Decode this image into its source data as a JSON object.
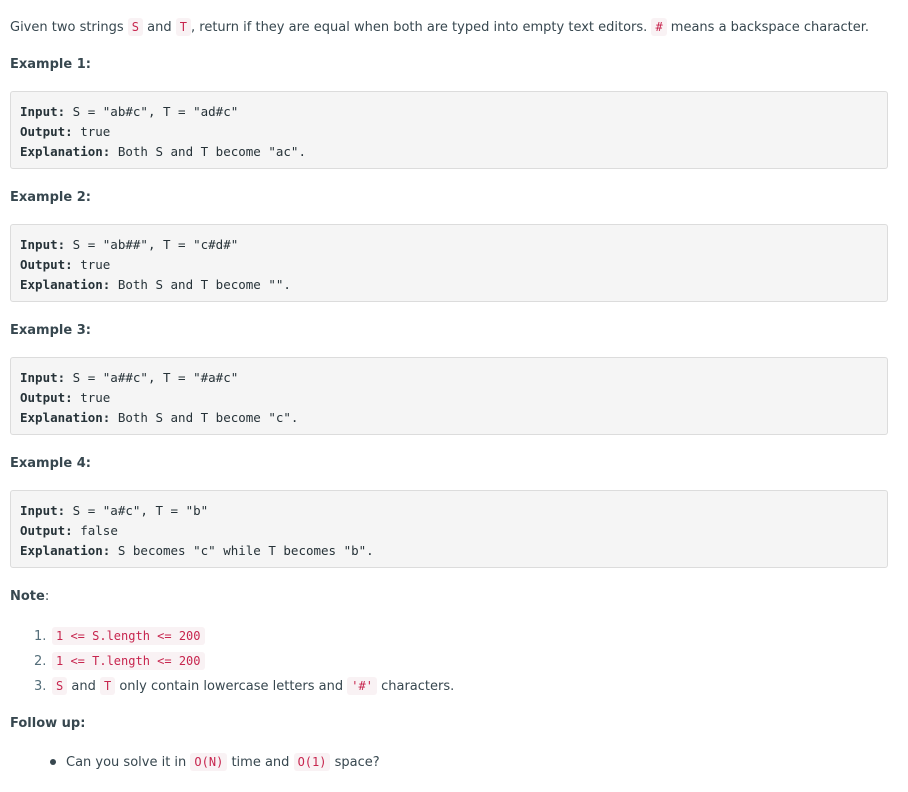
{
  "intro": {
    "t1": "Given two strings ",
    "c1": "S",
    "t2": " and ",
    "c2": "T",
    "t3": ", return if they are equal when both are typed into empty text editors. ",
    "c3": "#",
    "t4": " means a backspace character."
  },
  "examples": [
    {
      "heading": "Example 1:",
      "input_label": "Input:",
      "input": " S = \"ab#c\", T = \"ad#c\"",
      "output_label": "Output:",
      "output": " true",
      "explanation_label": "Explanation:",
      "explanation": " Both S and T become \"ac\"."
    },
    {
      "heading": "Example 2:",
      "input_label": "Input:",
      "input": " S = \"ab##\", T = \"c#d#\"",
      "output_label": "Output:",
      "output": " true",
      "explanation_label": "Explanation:",
      "explanation": " Both S and T become \"\"."
    },
    {
      "heading": "Example 3:",
      "input_label": "Input:",
      "input": " S = \"a##c\", T = \"#a#c\"",
      "output_label": "Output:",
      "output": " true",
      "explanation_label": "Explanation:",
      "explanation": " Both S and T become \"c\"."
    },
    {
      "heading": "Example 4:",
      "input_label": "Input:",
      "input": " S = \"a#c\", T = \"b\"",
      "output_label": "Output:",
      "output": " false",
      "explanation_label": "Explanation:",
      "explanation": " S becomes \"c\" while T becomes \"b\"."
    }
  ],
  "note": {
    "heading": "Note",
    "colon": ":",
    "items": [
      {
        "num": "1.",
        "code": "1 <= S.length <= 200"
      },
      {
        "num": "2.",
        "code": "1 <= T.length <= 200"
      },
      {
        "num": "3.",
        "code1": "S",
        "text1": " and ",
        "code2": "T",
        "text2": " only contain lowercase letters and ",
        "code3": "'#'",
        "text3": " characters."
      }
    ]
  },
  "follow_up": {
    "heading": "Follow up:",
    "items": [
      {
        "text1": "Can you solve it in ",
        "code1": "O(N)",
        "text2": " time and ",
        "code2": "O(1)",
        "text3": " space?"
      }
    ]
  }
}
